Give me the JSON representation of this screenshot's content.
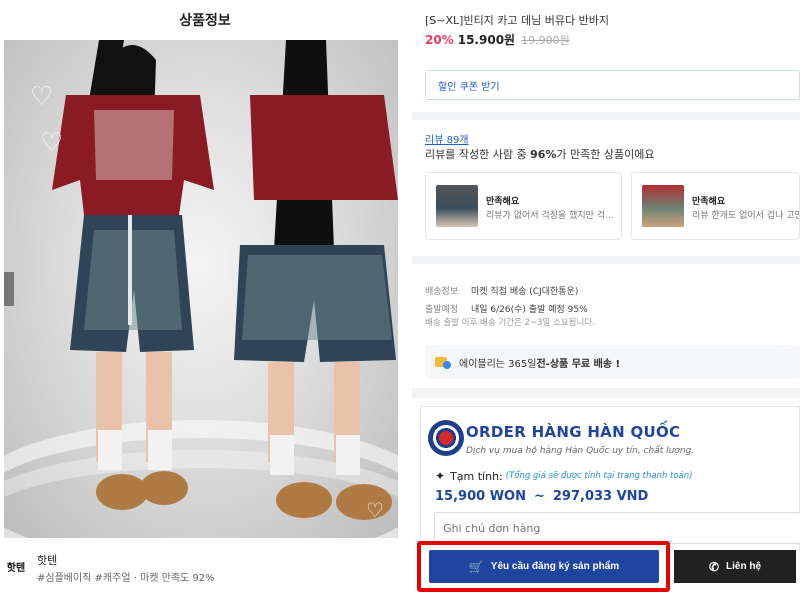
{
  "left": {
    "section_title": "상품정보",
    "brand_logo_text": "핫텐",
    "brand_name": "핫텐",
    "brand_tags": "#심플베이직 #캐주얼 · 마켓 만족도 92%",
    "image_dots": 4,
    "active_dot": 1
  },
  "product": {
    "title": "[S~XL]빈티지 카고 데님 버뮤다 반바지",
    "discount": "20%",
    "price": "15.900원",
    "original_price": "19.900원",
    "coupon_label": "할인 쿠폰 받기"
  },
  "reviews": {
    "count_link": "리뷰 89개",
    "summary_before": "리뷰를 작성한 사람 중 ",
    "summary_pct": "96%",
    "summary_after": "가 만족한 상품이에요",
    "cards": [
      {
        "label": "만족해요",
        "text": "리뷰가 없어서 걱정을 했지만 걱..."
      },
      {
        "label": "만족해요",
        "text": "리뷰 한개도 없어서 겁나 고민"
      }
    ]
  },
  "shipping": {
    "info_key": "배송정보",
    "info_value": "마켓 직접 배송 (CJ대한통운)",
    "eta_key": "출발예정",
    "eta_value": "내일 6/26(수) 출발 예정 95%",
    "note": "배송 출발 이후 배송 기간은 2~3일 소요됩니다.",
    "free_before": "에이블리는 365일 ",
    "free_bold": "전-상품 무료 배송 !"
  },
  "order": {
    "title": "ORDER HÀNG HÀN QUỐC",
    "subtitle": "Dịch vụ mua hộ hàng Hàn Quốc uy tín, chất lượng.",
    "temp_label": "Tạm tính:",
    "temp_hint": "(Tổng giá sẽ được tính tại trang thanh toán)",
    "price_won": "15,900 WON",
    "tilde": "~",
    "price_vnd": "297,033 VND",
    "note_placeholder": "Ghi chú đơn hàng",
    "request_button": "Yêu cầu đăng ký sản phẩm",
    "contact_button": "Liên hệ"
  },
  "colors": {
    "brand_blue": "#1f45a0",
    "discount_red": "#f0395c",
    "highlight_red": "#e60000"
  },
  "icons": [
    "heart-icon",
    "box-icon",
    "sparkle-icon",
    "cart-icon",
    "phone-icon"
  ]
}
